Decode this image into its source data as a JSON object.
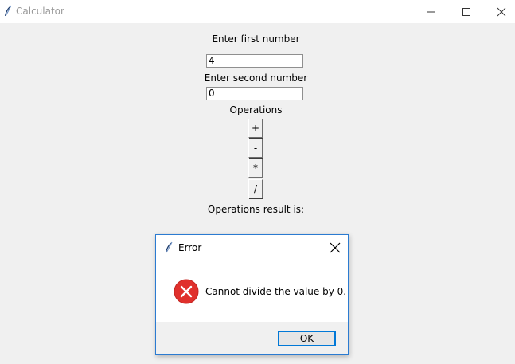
{
  "window": {
    "title": "Calculator"
  },
  "labels": {
    "first": "Enter first number",
    "second": "Enter second number",
    "operations": "Operations",
    "result": "Operations result is:"
  },
  "inputs": {
    "first_value": "4",
    "second_value": "0"
  },
  "operations": [
    "+",
    "-",
    "*",
    "/"
  ],
  "dialog": {
    "title": "Error",
    "message": "Cannot divide the value by 0.",
    "ok_label": "OK"
  },
  "colors": {
    "error_red": "#e0302c",
    "focus_blue": "#0078d7",
    "dialog_border": "#2b7bd1"
  }
}
